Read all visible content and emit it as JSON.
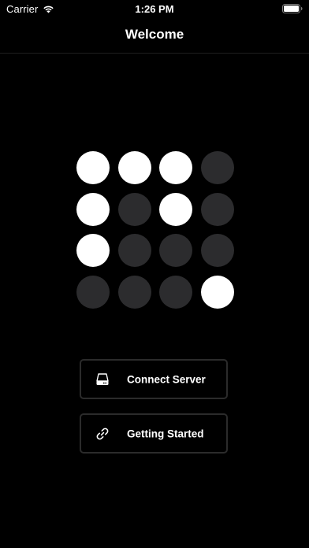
{
  "status_bar": {
    "carrier": "Carrier",
    "time": "1:26 PM",
    "wifi_icon": "wifi-icon",
    "battery_icon": "battery-icon"
  },
  "nav": {
    "title": "Welcome"
  },
  "logo_grid": {
    "rows": [
      [
        true,
        true,
        true,
        false
      ],
      [
        true,
        false,
        true,
        false
      ],
      [
        true,
        false,
        false,
        false
      ],
      [
        false,
        false,
        false,
        true
      ]
    ],
    "on_color": "#ffffff",
    "off_color": "#2c2c2e"
  },
  "buttons": {
    "connect": {
      "label": "Connect Server",
      "icon": "server-drive-icon"
    },
    "getting_started": {
      "label": "Getting Started",
      "icon": "link-icon"
    }
  },
  "colors": {
    "background": "#000000",
    "text": "#ffffff",
    "button_border": "#2b2b2b"
  }
}
